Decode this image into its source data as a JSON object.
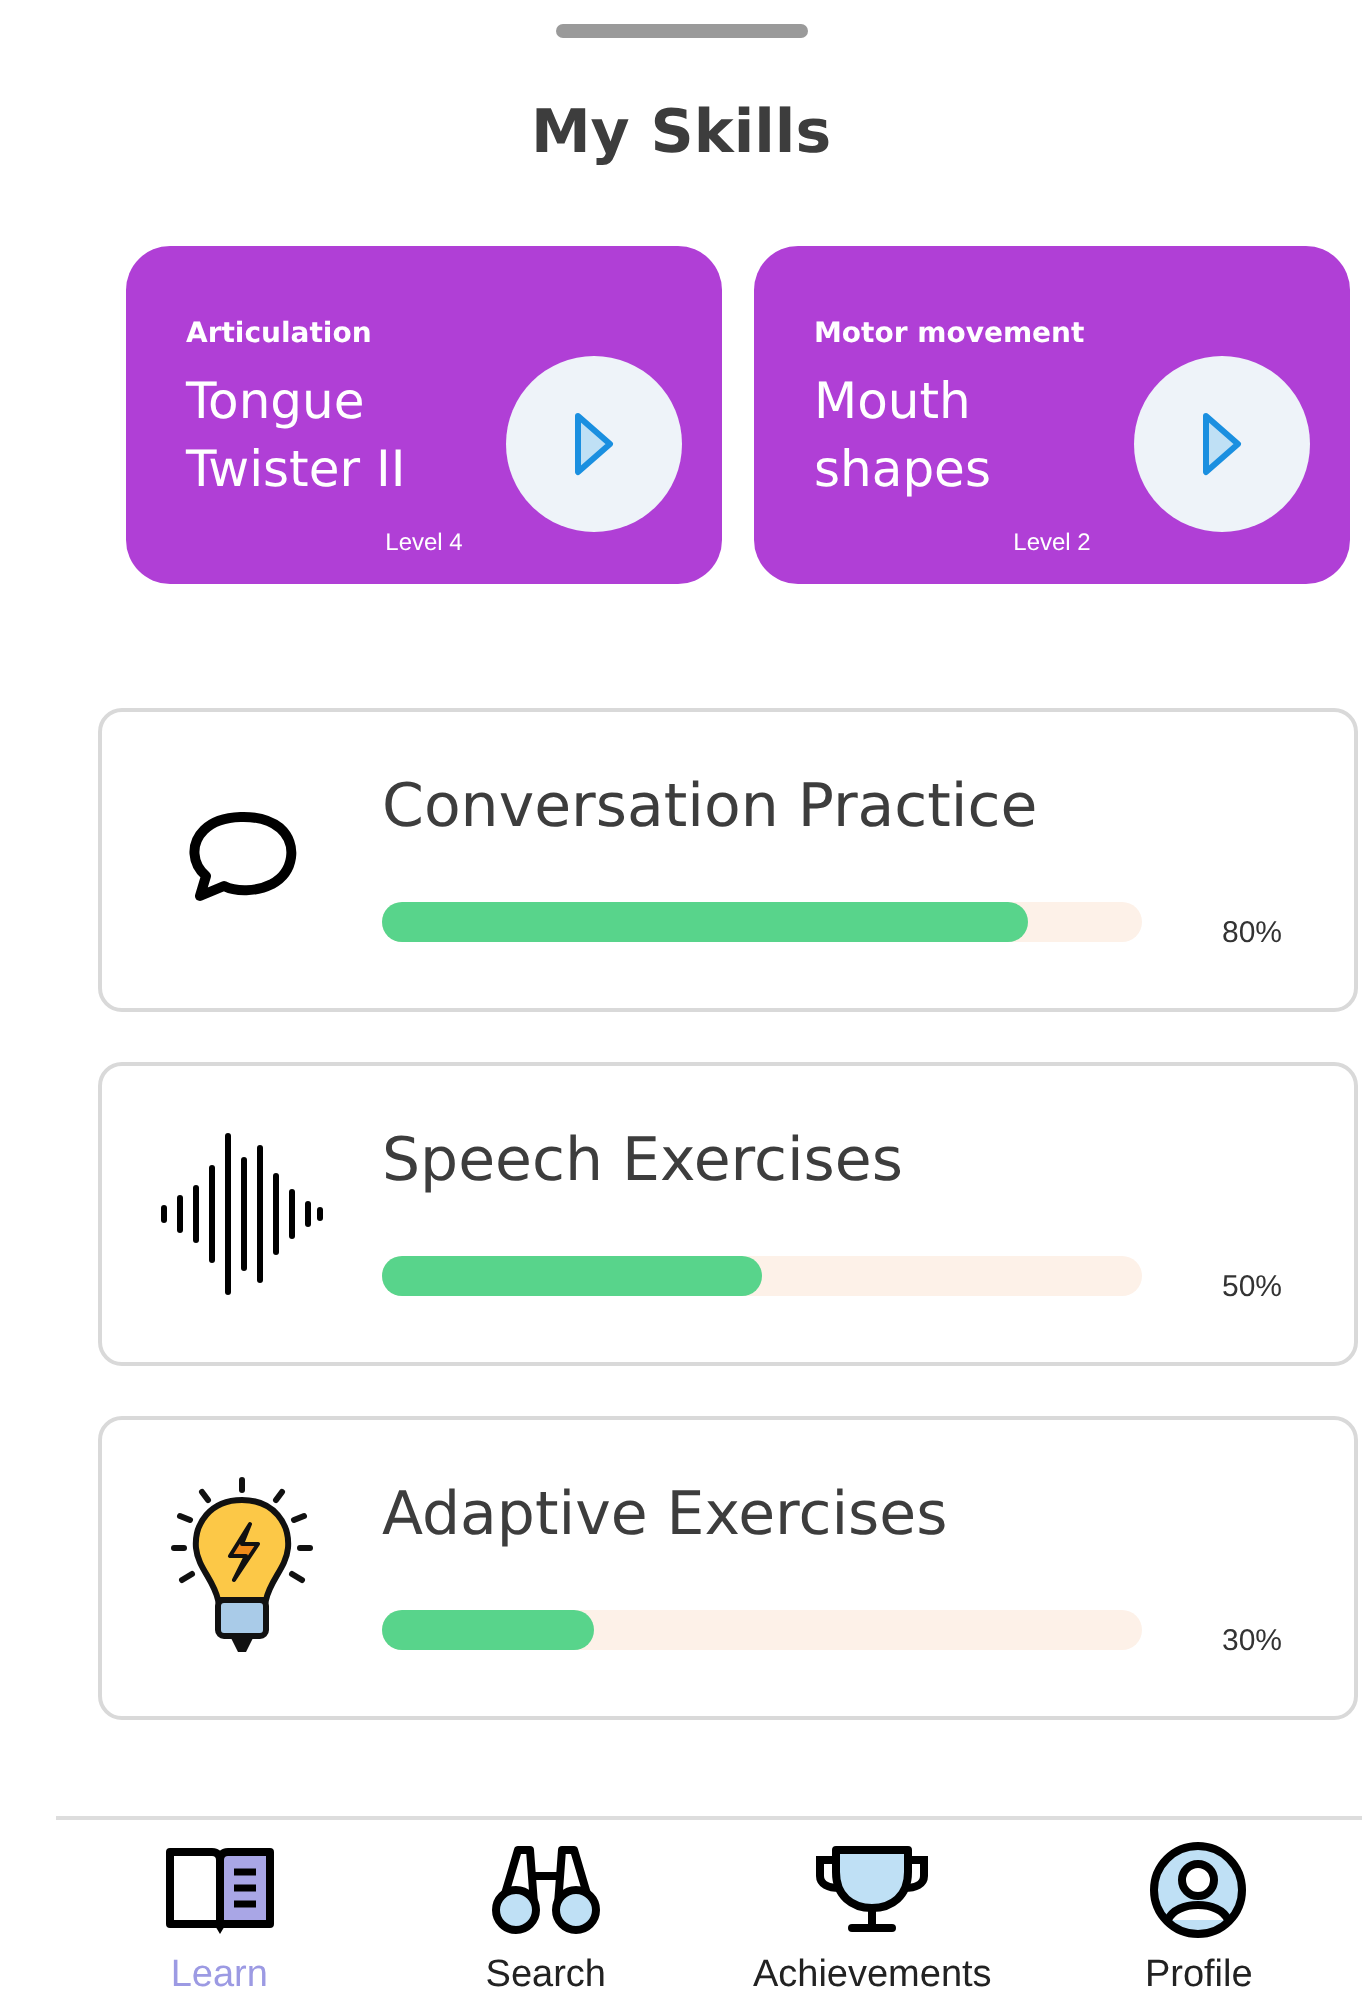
{
  "title": "My Skills",
  "featured": [
    {
      "category": "Articulation",
      "name": "Tongue Twister II",
      "level": "Level 4"
    },
    {
      "category": "Motor movement",
      "name": "Mouth shapes",
      "level": "Level 2"
    }
  ],
  "skills": [
    {
      "kind": "chat",
      "name": "Conversation Practice",
      "level": 0.85,
      "reading": "80%"
    },
    {
      "kind": "wave",
      "name": "Speech Exercises",
      "level": 0.5,
      "reading": "50%"
    },
    {
      "kind": "bulb",
      "name": "Adaptive Exercises",
      "level": 0.28,
      "reading": "30%"
    }
  ],
  "nav": [
    {
      "kind": "learn",
      "label": "Learn",
      "selected": true
    },
    {
      "kind": "search",
      "label": "Search",
      "selected": false
    },
    {
      "kind": "trophy",
      "label": "Achievements",
      "selected": false
    },
    {
      "kind": "profile",
      "label": "Profile",
      "selected": false
    }
  ]
}
